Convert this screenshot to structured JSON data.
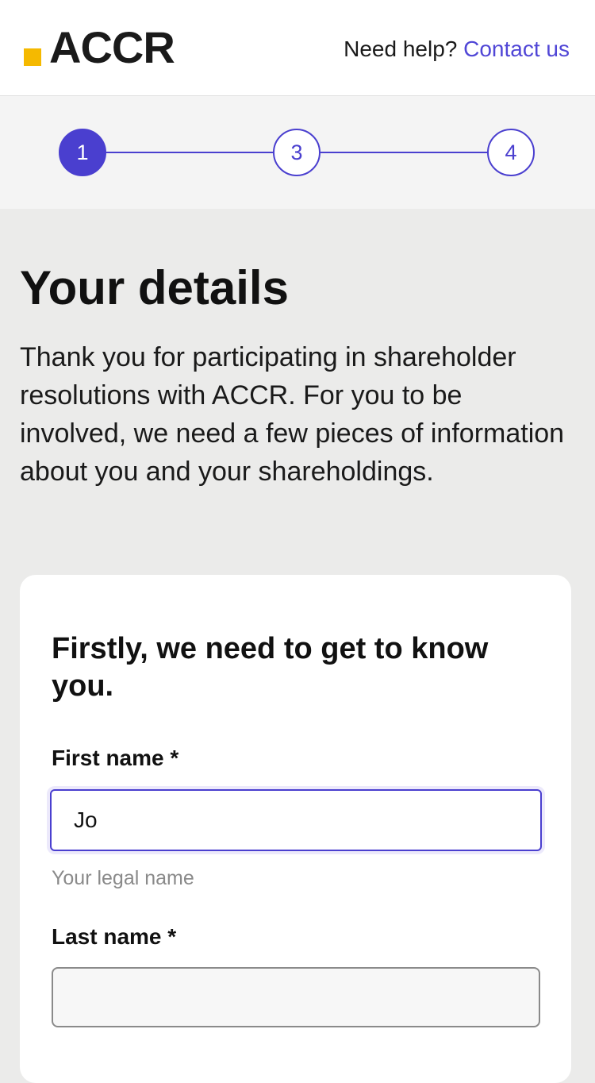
{
  "header": {
    "logo_text": "ACCR",
    "help_text": "Need help?",
    "contact_link": "Contact us"
  },
  "stepper": {
    "steps": [
      "1",
      "3",
      "4"
    ],
    "active_index": 0
  },
  "page": {
    "title": "Your details",
    "intro": "Thank you for participating in shareholder resolutions with ACCR. For you to be involved, we need a few pieces of information about you and your shareholdings."
  },
  "form": {
    "heading": "Firstly, we need to get to know you.",
    "first_name": {
      "label": "First name *",
      "value": "Jo",
      "hint": "Your legal name"
    },
    "last_name": {
      "label": "Last name *",
      "value": ""
    }
  },
  "colors": {
    "brand_yellow": "#f5b900",
    "accent_purple": "#4a3fcf",
    "link_purple": "#5046d6"
  }
}
